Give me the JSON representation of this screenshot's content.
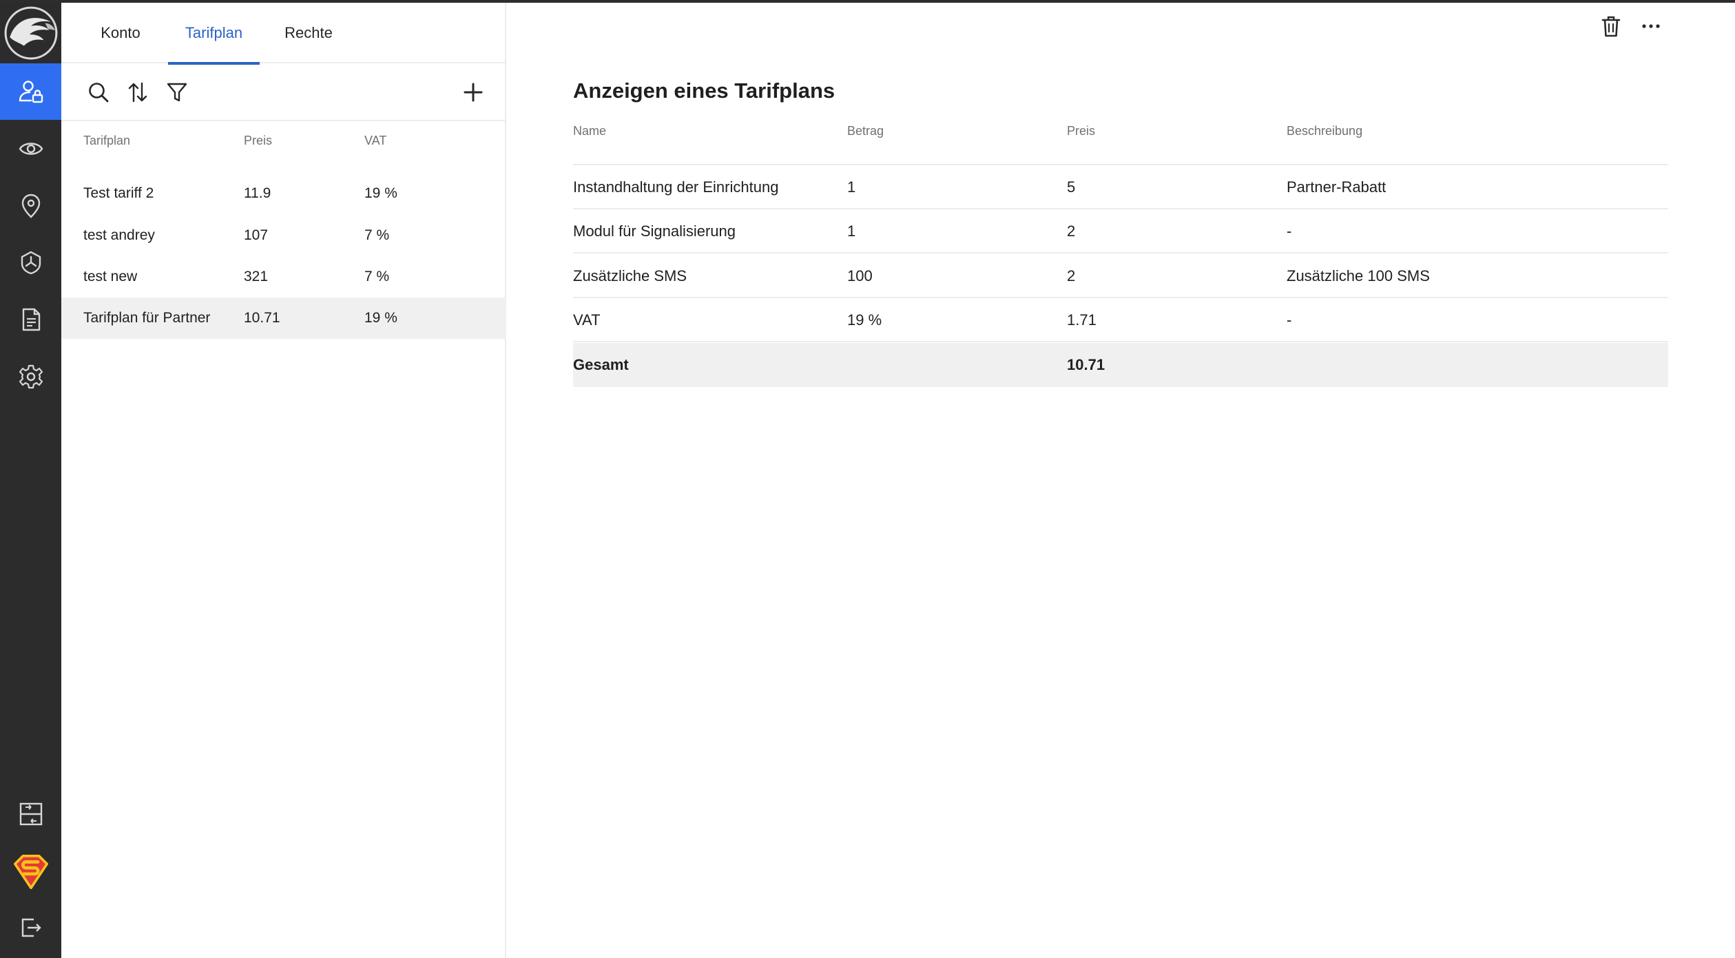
{
  "tabs": [
    {
      "label": "Konto"
    },
    {
      "label": "Tarifplan"
    },
    {
      "label": "Rechte"
    }
  ],
  "active_tab": "Tarifplan",
  "list": {
    "columns": [
      "Tarifplan",
      "Preis",
      "VAT"
    ],
    "rows": [
      {
        "name": "Test tariff 2",
        "price": "11.9",
        "vat": "19 %"
      },
      {
        "name": "test andrey",
        "price": "107",
        "vat": "7 %"
      },
      {
        "name": "test new",
        "price": "321",
        "vat": "7 %"
      },
      {
        "name": "Tarifplan für Partner",
        "price": "10.71",
        "vat": "19 %"
      }
    ],
    "selected": "Tarifplan für Partner"
  },
  "detail": {
    "title": "Anzeigen eines Tarifplans",
    "columns": [
      "Name",
      "Betrag",
      "Preis",
      "Beschreibung"
    ],
    "rows": [
      {
        "name": "Instandhaltung der Einrichtung",
        "amount": "1",
        "price": "5",
        "description": "Partner-Rabatt"
      },
      {
        "name": "Modul für Signalisierung",
        "amount": "1",
        "price": "2",
        "description": "-"
      },
      {
        "name": "Zusätzliche SMS",
        "amount": "100",
        "price": "2",
        "description": "Zusätzliche 100 SMS"
      },
      {
        "name": "VAT",
        "amount": "19 %",
        "price": "1.71",
        "description": "-"
      }
    ],
    "total": {
      "label": "Gesamt",
      "price": "10.71"
    }
  },
  "colors": {
    "rail": "#2c2c2c",
    "accent": "#2f6ef1",
    "tab_active": "#2b63c5",
    "selected_row": "#f0f0f0"
  },
  "icons": {
    "rail": [
      "eagle-logo",
      "user-lock-icon",
      "eye-icon",
      "location-pin-icon",
      "shield-icon",
      "document-icon",
      "gear-icon",
      "split-view-icon",
      "superman-avatar",
      "logout-icon"
    ],
    "toolbar": [
      "search-icon",
      "sort-icon",
      "filter-icon",
      "plus-icon"
    ],
    "detail_actions": [
      "trash-icon",
      "more-icon"
    ]
  }
}
